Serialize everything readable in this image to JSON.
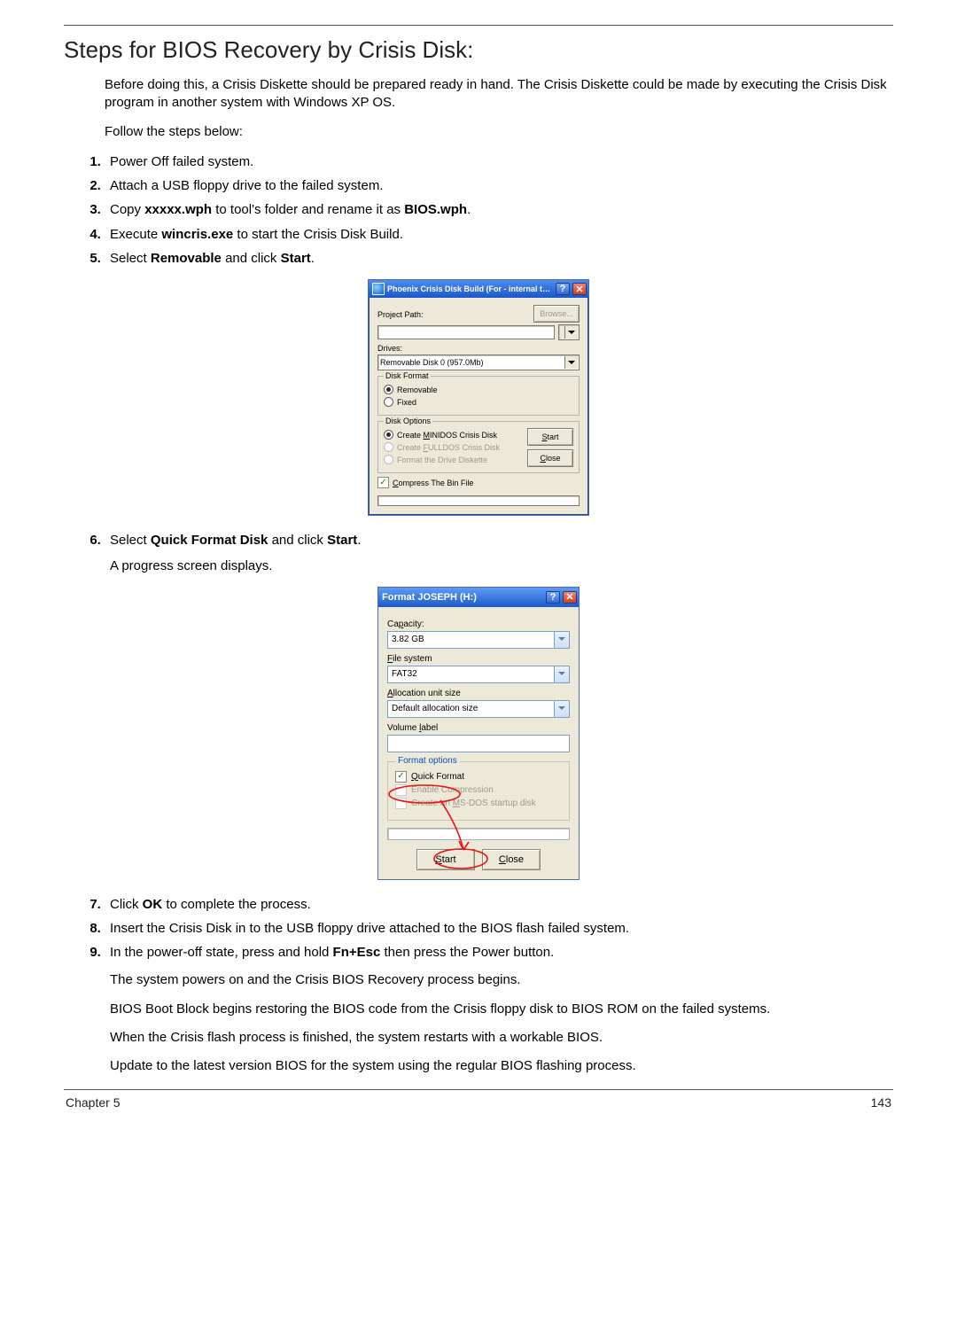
{
  "heading": "Steps for BIOS Recovery by Crisis Disk:",
  "intro": "Before doing this, a Crisis Diskette should be prepared ready in hand. The Crisis Diskette could be made by executing the Crisis Disk program in another system with Windows XP OS.",
  "follow": "Follow the steps below:",
  "steps_a": [
    "Power Off failed system.",
    "Attach a USB floppy drive to the failed system."
  ],
  "step3": {
    "pre": "Copy ",
    "bold1": "xxxxx.wph",
    "mid": " to tool's folder and rename it as ",
    "bold2": "BIOS.wph",
    "post": "."
  },
  "step4": {
    "pre": "Execute ",
    "bold": "wincris.exe",
    "post": " to start the Crisis Disk Build."
  },
  "step5": {
    "pre": "Select ",
    "bold1": "Removable",
    "mid": " and click ",
    "bold2": "Start",
    "post": "."
  },
  "phoenix": {
    "title": "Phoenix Crisis Disk Build (For - internal test, ",
    "project_path_label": "Project Path:",
    "browse": "Browse...",
    "drives_label": "Drives:",
    "drive_selected": "Removable Disk 0 (957.0Mb)",
    "disk_format_label": "Disk Format",
    "removable": "Removable",
    "fixed": "Fixed",
    "disk_options_label": "Disk Options",
    "opt_minidos_pre": "Create ",
    "opt_minidos_u": "M",
    "opt_minidos_post": "INIDOS Crisis Disk",
    "opt_fulldos_pre": "Create ",
    "opt_fulldos_u": "F",
    "opt_fulldos_post": "ULLDOS Crisis Disk",
    "opt_formatdrive": "Format the Drive Diskette",
    "start": "Start",
    "start_u": "S",
    "close": "Close",
    "close_u": "C",
    "compress_u": "C",
    "compress_post": "ompress The Bin File"
  },
  "step6": {
    "pre": "Select ",
    "bold1": "Quick Format Disk",
    "mid": " and click ",
    "bold2": "Start",
    "post": "."
  },
  "step6_sub": "A progress screen displays.",
  "format": {
    "title": "Format JOSEPH (H:)",
    "capacity_label": "Capacity:",
    "capacity_u": "p",
    "capacity": "3.82 GB",
    "fs_label": "File system",
    "fs_u": "F",
    "fs": "FAT32",
    "au_label": "Allocation unit size",
    "au_u": "A",
    "au": "Default allocation size",
    "vol_label": "Volume label",
    "vol_u": "l",
    "fmt_options": "Format options",
    "quick": "Quick Format",
    "quick_u": "Q",
    "enable_comp": "Enable Compression",
    "msdos": "Create an MS-DOS startup disk",
    "msdos_u": "M",
    "start": "Start",
    "start_u": "S",
    "close": "Close",
    "close_u": "C"
  },
  "step7": {
    "pre": "Click ",
    "bold": "OK",
    "post": " to complete the process."
  },
  "step8": "Insert the Crisis Disk in to the USB floppy drive attached to the BIOS flash failed system.",
  "step9": {
    "pre": "In the power-off state, press and hold ",
    "bold": "Fn+Esc",
    "post": " then press the Power button."
  },
  "tail": [
    "The system powers on and the Crisis BIOS Recovery process begins.",
    "BIOS Boot Block begins restoring the BIOS code from the Crisis floppy disk to BIOS ROM on the failed systems.",
    "When the Crisis flash process is finished, the system restarts with a workable BIOS.",
    "Update to the latest version BIOS for the system using the regular BIOS flashing process."
  ],
  "footer_left": "Chapter 5",
  "footer_right": "143"
}
